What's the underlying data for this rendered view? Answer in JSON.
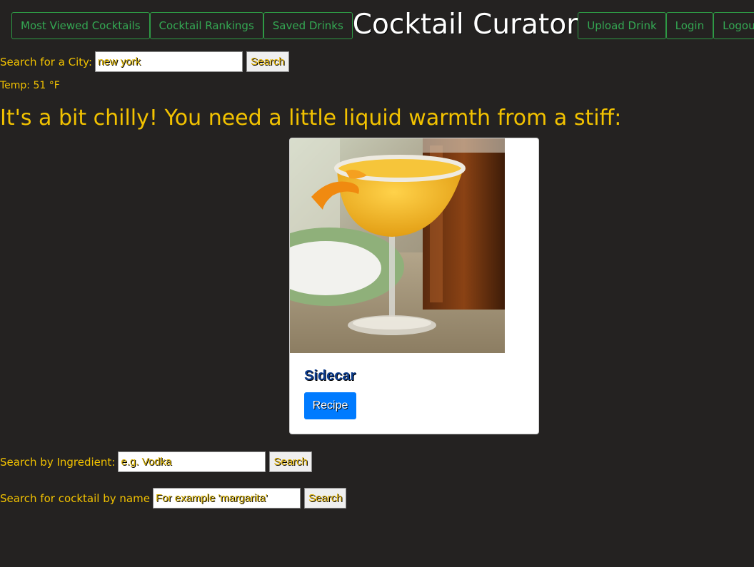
{
  "nav": {
    "left_items": [
      {
        "label": "Most Viewed Cocktails"
      },
      {
        "label": "Cocktail Rankings"
      },
      {
        "label": "Saved Drinks"
      }
    ],
    "brand": "Cocktail Curator",
    "right_items": [
      {
        "label": "Upload Drink"
      },
      {
        "label": "Login"
      },
      {
        "label": "Logout"
      }
    ]
  },
  "city_search": {
    "label": "Search for a City:",
    "value": "new york",
    "button": "Search"
  },
  "weather": {
    "temp_text": "Temp: 51 °F"
  },
  "headline": "It's a bit chilly! You need a little liquid warmth from a stiff:",
  "card": {
    "title": "Sidecar",
    "button": "Recipe",
    "image_icon": "cocktail-photo"
  },
  "ingredient_search": {
    "label": "Search by Ingredient:",
    "placeholder": "e.g. Vodka",
    "button": "Search"
  },
  "name_search": {
    "label": "Search for cocktail by name",
    "placeholder": "For example 'margarita'",
    "button": "Search"
  },
  "colors": {
    "background": "#242221",
    "accent_yellow": "#f2c200",
    "nav_green": "#34a853",
    "recipe_blue": "#007bff"
  }
}
